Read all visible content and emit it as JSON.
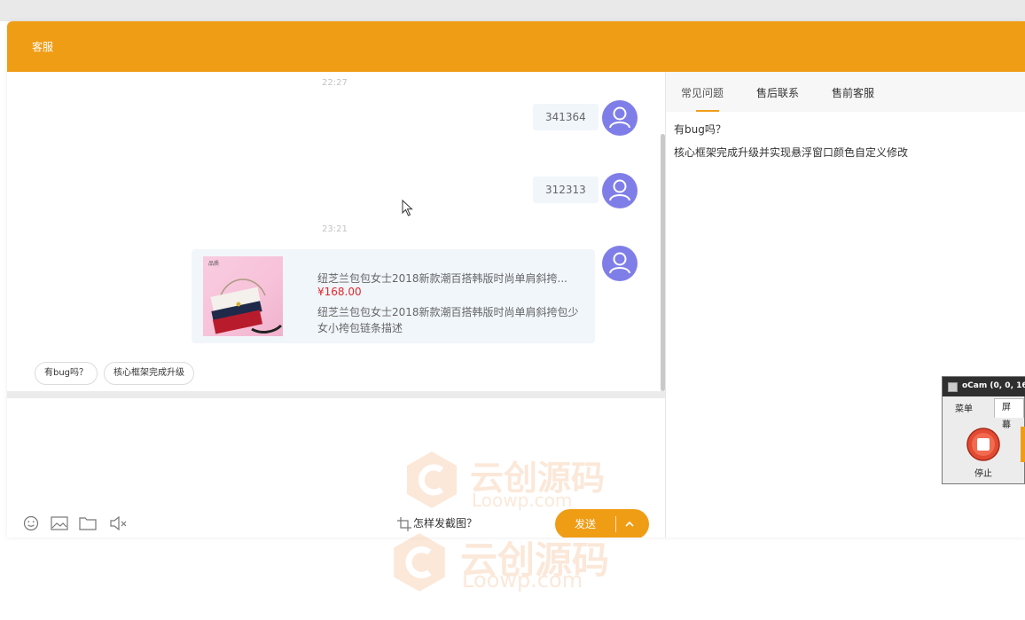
{
  "header": {
    "title": "客服"
  },
  "chat": {
    "timestamps": [
      "22:27",
      "23:21"
    ],
    "messages": [
      "341364",
      "312313"
    ],
    "product": {
      "title": "纽芝兰包包女士2018新款潮百搭韩版时尚单肩斜挎...",
      "price": "¥168.00",
      "description": "纽芝兰包包女士2018新款潮百搭韩版时尚单肩斜挎包少女小挎包链条描述"
    },
    "quick_tags": [
      "有bug吗？",
      "核心框架完成升级"
    ]
  },
  "toolbar": {
    "icons": [
      "emoji-icon",
      "image-icon",
      "folder-icon",
      "mute-icon",
      "screenshot-icon"
    ],
    "howto": "怎样发截图？",
    "send_label": "发送"
  },
  "side_panel": {
    "tabs": [
      "常见问题",
      "售后联系",
      "售前客服"
    ],
    "active_tab": 0,
    "faq": [
      "有bug吗？",
      "核心框架完成升级并实现悬浮窗口颜色自定义修改"
    ]
  },
  "watermark": {
    "cn": "云创源码",
    "en": "Loowp.com"
  },
  "ocam": {
    "title": "oCam (0, 0, 16",
    "tabs": [
      "菜单",
      "屏幕"
    ],
    "stop_label": "停止"
  },
  "colors": {
    "brand": "#f09d16",
    "avatar": "#7f7ee8",
    "bubble": "#f1f6fb",
    "price": "#e0292b"
  }
}
